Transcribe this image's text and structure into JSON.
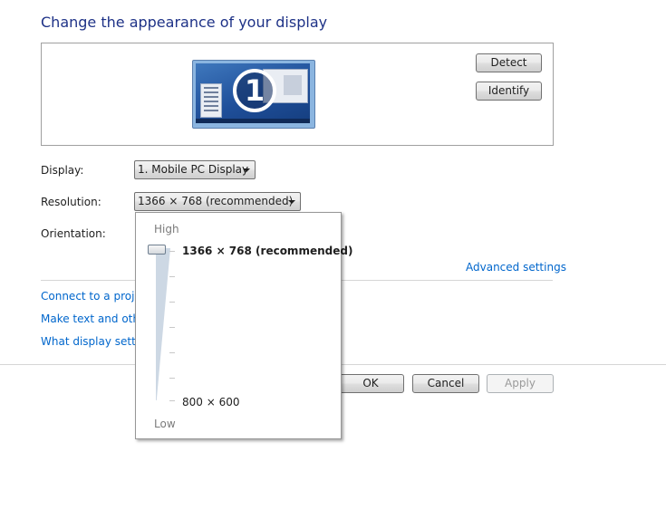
{
  "page": {
    "title": "Change the appearance of your display"
  },
  "preview": {
    "monitor_number": "1",
    "detect_label": "Detect",
    "identify_label": "Identify"
  },
  "settings": {
    "display_label": "Display:",
    "display_value": "1. Mobile PC Display",
    "resolution_label": "Resolution:",
    "resolution_value": "1366 × 768 (recommended)",
    "orientation_label": "Orientation:"
  },
  "links": {
    "advanced": "Advanced settings",
    "connect_projector": "Connect to a projec",
    "make_text": "Make text and other",
    "what_display": "What display setting"
  },
  "resolution_dropdown": {
    "high_label": "High",
    "low_label": "Low",
    "top_option": "1366 × 768 (recommended)",
    "bottom_option": "800 × 600",
    "slider_position": 1.0
  },
  "footer": {
    "ok_label": "OK",
    "cancel_label": "Cancel",
    "apply_label": "Apply"
  }
}
